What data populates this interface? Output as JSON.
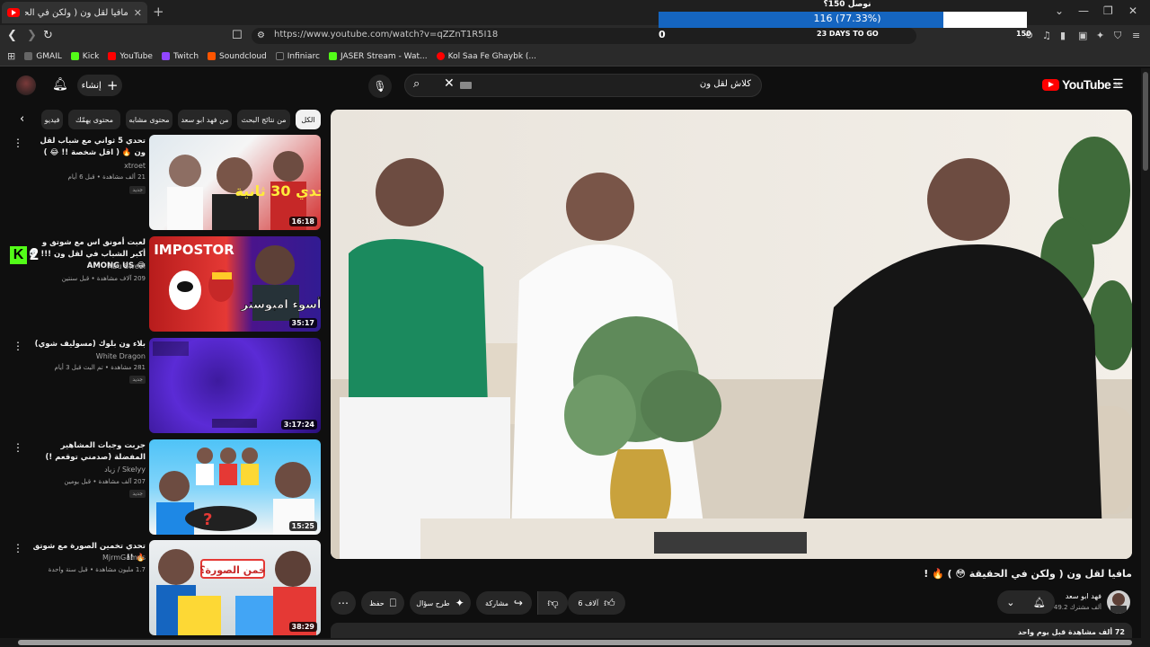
{
  "browser": {
    "tab_title": "مافيا لقل ون ( ولكن في الحقيقة 😳 )",
    "tab_close": "✕",
    "new_tab": "+",
    "url": "https://www.youtube.com/watch?v=qZZnT1R5I18",
    "window_controls": [
      "⌄",
      "—",
      "❐",
      "✕"
    ],
    "bookmarks": [
      {
        "label": "GMAIL",
        "color": "#666666"
      },
      {
        "label": "Kick",
        "color": "#53fc18"
      },
      {
        "label": "YouTube",
        "color": "#ff0000"
      },
      {
        "label": "Twitch",
        "color": "#9146ff"
      },
      {
        "label": "Soundcloud",
        "color": "#ff5500"
      },
      {
        "label": "Infiniarc",
        "color": "#222222"
      },
      {
        "label": "JASER Stream - Wat...",
        "color": "#53fc18"
      },
      {
        "label": "Kol Saa Fe Ghaybk (...",
        "color": "#ff0000"
      }
    ]
  },
  "goal_overlay": {
    "title": "نوصل 150؟",
    "progress_text": "116 (77.33%)",
    "progress_fraction": 0.7733,
    "left_value": "0",
    "days_text": "23 DAYS TO GO",
    "right_value": "150"
  },
  "youtube": {
    "create_label": "إنشاء",
    "search_text": "كلاش لقل ون",
    "logo_text": "YouTube",
    "region": "SA",
    "chips": [
      "الكل",
      "من نتائج البحث",
      "من فهد ابو سعد",
      "محتوى مشابه",
      "محتوى يهمّك",
      "فيديو"
    ],
    "kick_count": "2",
    "recommendations": [
      {
        "title": "تحدي 5 ثواني مع شباب لقل ون 🔥 ( اقل شخصة !! 😂 )",
        "channel": "xtroet",
        "meta": "21 ألف مشاهدة • قبل 6 أيام",
        "badge": "جديد",
        "duration": "16:18",
        "thumb_text": "تحدي 30 ثانية"
      },
      {
        "title": "لعبت أمونق اس مع شوتق و أكبر الشباب في لقل ون !!! 💀😂 AMONG US",
        "channel": "Abu Swe7l",
        "meta": "209 آلاف مشاهدة • قبل سنتين",
        "badge": "",
        "duration": "35:17",
        "thumb_text": "IMPOSTOR",
        "thumb_text2": "أسوء امبوستر!"
      },
      {
        "title": "بلاء ون بلوك (مسوليف شوي)",
        "channel": "White Dragon",
        "meta": "281 مشاهدة • تم البث قبل 3 أيام",
        "badge": "جديد",
        "duration": "3:17:24"
      },
      {
        "title": "جربت وجبات المشاهير المفضلة (صدمني توقعم !)",
        "channel": "زياد / Skelyy",
        "meta": "207 آلف مشاهدة • قبل يومين",
        "badge": "جديد",
        "duration": "15:25"
      },
      {
        "title": "تحدي تخمين الصورة مع شوتق 🔥 !!",
        "channel": "MjrmGames",
        "meta": "1.7 مليون مشاهدة • قبل سنة واحدة",
        "badge": "",
        "duration": "38:29",
        "thumb_text": "خمن الصورة؟"
      }
    ],
    "video": {
      "title": "مافيا لقل ون ( ولكن في الحقيقة 😳 ) 🔥 !",
      "channel_name": "فهد ابو سعد",
      "subscribers": "49.2 ألف مشترك",
      "likes": "6 آلاف",
      "share_label": "مشاركة",
      "ask_label": "طرح سؤال",
      "save_label": "حفظ",
      "description_stats": "72 ألف مشاهدة  قبل يوم واحد"
    }
  }
}
